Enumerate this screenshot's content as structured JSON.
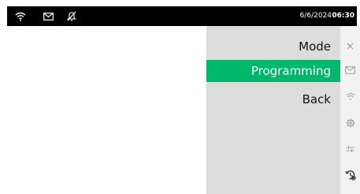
{
  "status_bar": {
    "date": "6/6/2024",
    "time": "06:30",
    "icons": [
      "wifi-icon",
      "mail-icon",
      "bell-off-icon"
    ]
  },
  "menu": {
    "items": [
      {
        "label": "Mode",
        "active": false
      },
      {
        "label": "Programming",
        "active": true
      },
      {
        "label": "Back",
        "active": false
      }
    ],
    "active_color": "#00b86b"
  },
  "side_rail": {
    "icons": [
      "close-icon",
      "mail-icon",
      "wifi-icon",
      "gear-icon",
      "sliders-icon",
      "history-settings-icon"
    ]
  }
}
